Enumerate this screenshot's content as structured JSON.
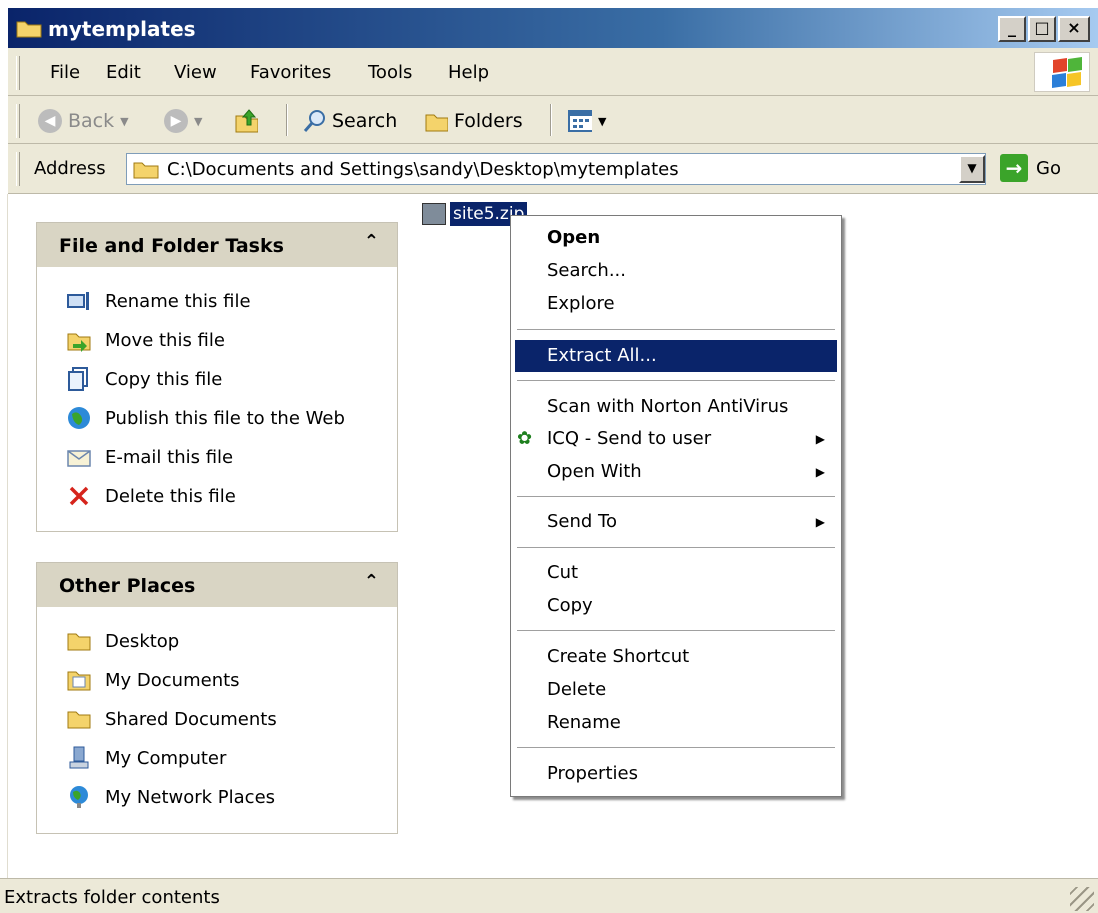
{
  "window": {
    "title": "mytemplates"
  },
  "menubar": {
    "items": [
      "File",
      "Edit",
      "View",
      "Favorites",
      "Tools",
      "Help"
    ]
  },
  "toolbar": {
    "back": "Back",
    "search": "Search",
    "folders": "Folders"
  },
  "address": {
    "label": "Address",
    "path": "C:\\Documents and Settings\\sandy\\Desktop\\mytemplates",
    "go": "Go"
  },
  "file_tasks": {
    "title": "File and Folder Tasks",
    "items": [
      "Rename this file",
      "Move this file",
      "Copy this file",
      "Publish this file to the Web",
      "E-mail this file",
      "Delete this file"
    ]
  },
  "other_places": {
    "title": "Other Places",
    "items": [
      "Desktop",
      "My Documents",
      "Shared Documents",
      "My Computer",
      "My Network Places"
    ]
  },
  "file": {
    "name": "site5.zip"
  },
  "context_menu": {
    "items": [
      "Open",
      "Search...",
      "Explore",
      "Extract All...",
      "Scan with Norton AntiVirus",
      "ICQ - Send to user",
      "Open With",
      "Send To",
      "Cut",
      "Copy",
      "Create Shortcut",
      "Delete",
      "Rename",
      "Properties"
    ],
    "highlighted": "Extract All..."
  },
  "status": {
    "text": "Extracts folder contents"
  },
  "colors": {
    "title_bar": "#0a246a",
    "highlight": "#0a246a",
    "panel_header": "#d9d5c4"
  }
}
